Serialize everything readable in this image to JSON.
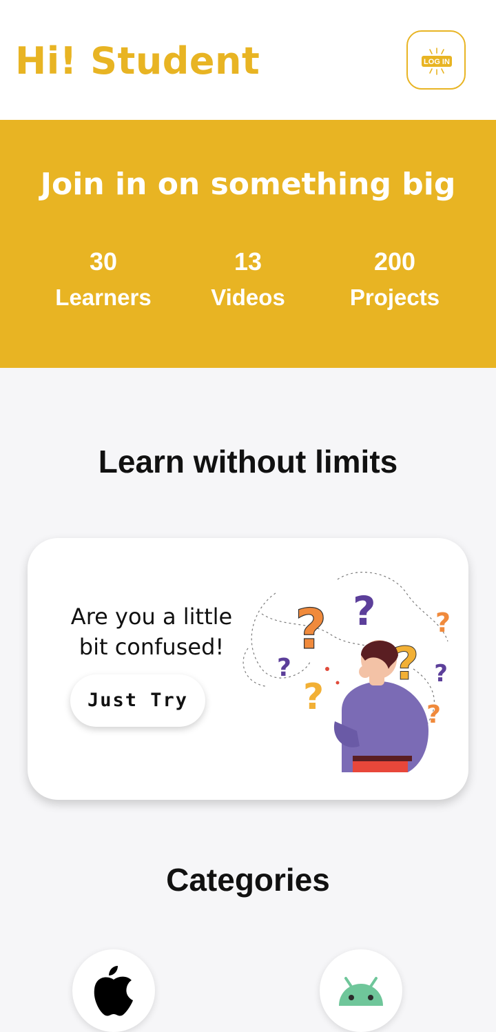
{
  "header": {
    "title": "Hi! Student",
    "login_label": "LOG IN",
    "login_icon": "login-icon"
  },
  "banner": {
    "title": "Join in on something big",
    "stats": [
      {
        "value": "30",
        "label": "Learners"
      },
      {
        "value": "13",
        "label": "Videos"
      },
      {
        "value": "200",
        "label": "Projects"
      }
    ]
  },
  "learn": {
    "title": "Learn without limits",
    "card": {
      "line1": "Are you a little",
      "line2": "bit confused!",
      "button_label": "Just Try",
      "illustration": "confused-person-question-marks"
    }
  },
  "categories": {
    "title": "Categories",
    "items": [
      {
        "icon": "apple-icon"
      },
      {
        "icon": "android-icon"
      }
    ]
  },
  "colors": {
    "accent": "#e8b423",
    "background": "#f6f6f8",
    "card": "#ffffff",
    "text": "#111111"
  }
}
